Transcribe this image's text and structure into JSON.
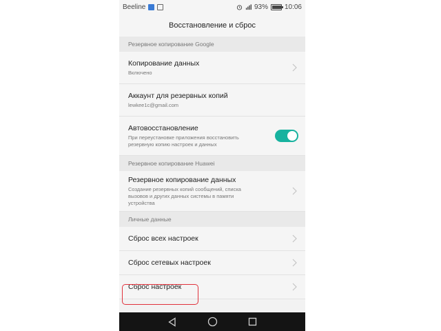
{
  "status_bar": {
    "carrier": "Beeline",
    "battery": "93%",
    "time": "10:06"
  },
  "header": {
    "title": "Восстановление и сброс"
  },
  "sections": [
    {
      "label": "Резервное копирование Google",
      "items": [
        {
          "title": "Копирование данных",
          "subtitle": "Включено",
          "control": "chevron"
        },
        {
          "title": "Аккаунт для резервных копий",
          "subtitle": "lewkee1c@gmail.com",
          "control": "none"
        },
        {
          "title": "Автовосстановление",
          "subtitle": "При переустановке приложения восстановить резервную копию настроек и данных",
          "control": "toggle",
          "toggle_on": true
        }
      ]
    },
    {
      "label": "Резервное копирование Huawei",
      "items": [
        {
          "title": "Резервное копирование данных",
          "subtitle": "Создание резервных копий сообщений, списка вызовов и других данных системы в памяти устройства",
          "control": "chevron"
        }
      ]
    },
    {
      "label": "Личные данные",
      "items": [
        {
          "title": "Сброс всех настроек",
          "control": "chevron"
        },
        {
          "title": "Сброс сетевых настроек",
          "control": "chevron"
        },
        {
          "title": "Сброс настроек",
          "control": "chevron",
          "highlighted": true
        }
      ]
    }
  ],
  "colors": {
    "toggle_on": "#17b29f",
    "highlight_border": "#e0303a",
    "nav_bar": "#141414"
  },
  "icons": {
    "nav_back": "back-triangle-icon",
    "nav_home": "home-circle-icon",
    "nav_recent": "recent-square-icon"
  }
}
